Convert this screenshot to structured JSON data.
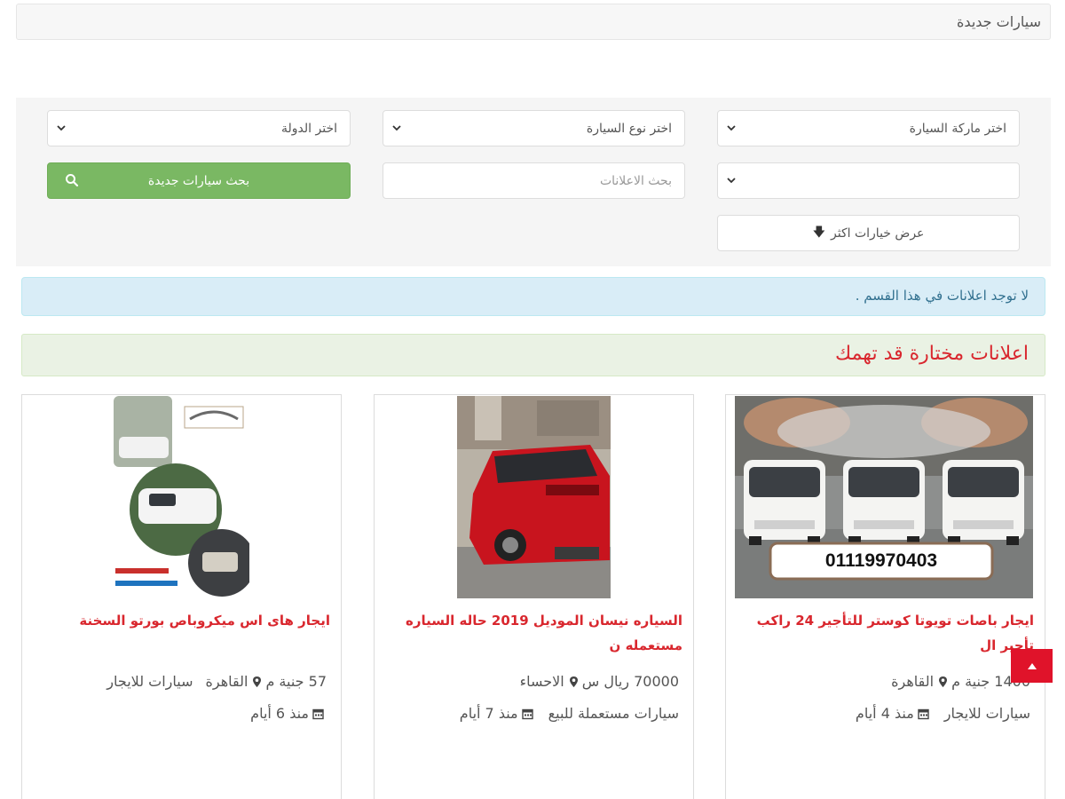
{
  "breadcrumb": {
    "title": "سيارات جديدة"
  },
  "filters": {
    "brand_select": "اختر ماركة السيارة",
    "type_select": "اختر نوع السيارة",
    "country_select": "اختر الدولة",
    "model_select": "",
    "search_placeholder": "بحث الاعلانات",
    "search_button": "بحث سيارات جديدة",
    "more_options": "عرض خيارات اكثر"
  },
  "alert": {
    "text": "لا توجد اعلانات في هذا القسم ."
  },
  "featured": {
    "title": "اعلانات مختارة قد تهمك"
  },
  "cards": [
    {
      "title": "ايجار باصات تويوتا كوستر للتأجير 24 راكب تأجير ال",
      "price": "1400 جنية م",
      "location": "القاهرة",
      "category": "سيارات للايجار",
      "date": "منذ 4 أيام",
      "phone": "01119970403"
    },
    {
      "title": "السياره نيسان الموديل 2019 حاله السياره مستعمله ن",
      "price": "70000 ريال س",
      "location": "الاحساء",
      "category": "سيارات مستعملة للبيع",
      "date": "منذ 7 أيام"
    },
    {
      "title": "ايجار هاى اس ميكروباص بورتو السخنة",
      "price": "57 جنية م",
      "location": "القاهرة",
      "category": "سيارات للايجار",
      "date": "منذ 6 أيام"
    }
  ],
  "colors": {
    "accent_red": "#d9272e",
    "button_green": "#7ab863",
    "info_bg": "#d9edf7",
    "featured_bg": "#eaf2e4"
  }
}
